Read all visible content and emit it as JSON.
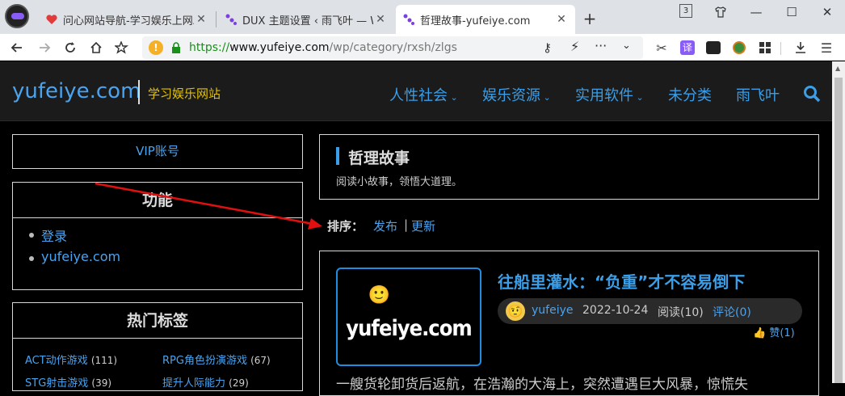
{
  "browser": {
    "tabs": [
      {
        "title": "问心网站导航-学习娱乐上网助手",
        "active": false
      },
      {
        "title": "DUX 主题设置 ‹ 雨飞叶 — WordPress",
        "active": false
      },
      {
        "title": "哲理故事-yufeiye.com",
        "active": true
      }
    ],
    "new_tab": "+",
    "tab_count": "3",
    "url_scheme": "https://",
    "url_host": "www.yufeiye.com",
    "url_path": "/wp/category/rxsh/zlgs",
    "icons": {
      "back": "back-arrow-icon",
      "forward": "forward-arrow-icon",
      "reload": "reload-icon",
      "home": "home-icon",
      "translate_label": "译"
    },
    "colors": {
      "accent": "#3a9ee8",
      "url_green": "#1a8f1a",
      "warn": "#f6b026"
    }
  },
  "site": {
    "logo": "yufeiye.com",
    "tagline": "学习娱乐网站",
    "nav": [
      {
        "label": "人性社会",
        "dropdown": true
      },
      {
        "label": "娱乐资源",
        "dropdown": true
      },
      {
        "label": "实用软件",
        "dropdown": true
      },
      {
        "label": "未分类",
        "dropdown": false
      },
      {
        "label": "雨飞叶",
        "dropdown": false
      }
    ],
    "search_icon": "search-icon"
  },
  "sidebar": {
    "vip": "VIP账号",
    "func_title": "功能",
    "func_links": [
      "登录",
      "yufeiye.com"
    ],
    "tags_title": "热门标签",
    "tags": [
      {
        "name": "ACT动作游戏",
        "count": "(111)"
      },
      {
        "name": "RPG角色扮演游戏",
        "count": "(67)"
      },
      {
        "name": "STG射击游戏",
        "count": "(39)"
      },
      {
        "name": "提升人际能力",
        "count": "(29)"
      }
    ]
  },
  "category": {
    "title": "哲理故事",
    "desc": "阅读小故事，领悟大道理。"
  },
  "sort": {
    "label": "排序：",
    "publish": "发布",
    "sep": "|",
    "update": "更新"
  },
  "post": {
    "thumb_emojis": "🙂😉😊😜",
    "thumb_text": "yufeiye.com",
    "title": "往船里灌水：“负重”才不容易倒下",
    "author": "yufeiye",
    "date": "2022-10-24",
    "views": "阅读(10)",
    "comments": "评论(0)",
    "like": "赞(1)",
    "excerpt": "一艘货轮卸货后返航，在浩瀚的大海上，突然遭遇巨大风暴，惊慌失"
  }
}
